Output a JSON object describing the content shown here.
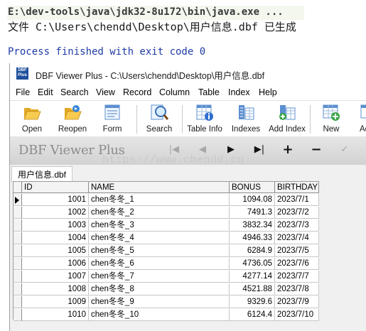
{
  "console": {
    "command": "E:\\dev-tools\\java\\jdk32-8u172\\bin\\java.exe ...",
    "output": "文件 C:\\Users\\chendd\\Desktop\\用户信息.dbf 已生成",
    "exit": "Process finished with exit code 0"
  },
  "window": {
    "logo": "DBF Plus",
    "title": "DBF Viewer Plus - C:\\Users\\chendd\\Desktop\\用户信息.dbf"
  },
  "menu": [
    "File",
    "Edit",
    "Search",
    "View",
    "Record",
    "Column",
    "Table",
    "Index",
    "Help"
  ],
  "toolbar": {
    "open": "Open",
    "reopen": "Reopen",
    "form": "Form",
    "search": "Search",
    "table_info": "Table Info",
    "indexes": "Indexes",
    "add_index": "Add Index",
    "new": "New",
    "add_partial": "Ad"
  },
  "navbar": {
    "brand": "DBF Viewer Plus"
  },
  "watermark": "https://www.chendd.cn",
  "tab": {
    "label": "用户信息.dbf"
  },
  "grid": {
    "columns": [
      "ID",
      "NAME",
      "BONUS",
      "BIRTHDAY"
    ],
    "rows": [
      {
        "id": "1001",
        "name": "chen冬冬_1",
        "bonus": "1094.08",
        "birthday": "2023/7/1"
      },
      {
        "id": "1002",
        "name": "chen冬冬_2",
        "bonus": "7491.3",
        "birthday": "2023/7/2"
      },
      {
        "id": "1003",
        "name": "chen冬冬_3",
        "bonus": "3832.34",
        "birthday": "2023/7/3"
      },
      {
        "id": "1004",
        "name": "chen冬冬_4",
        "bonus": "4946.33",
        "birthday": "2023/7/4"
      },
      {
        "id": "1005",
        "name": "chen冬冬_5",
        "bonus": "6284.9",
        "birthday": "2023/7/5"
      },
      {
        "id": "1006",
        "name": "chen冬冬_6",
        "bonus": "4736.05",
        "birthday": "2023/7/6"
      },
      {
        "id": "1007",
        "name": "chen冬冬_7",
        "bonus": "4277.14",
        "birthday": "2023/7/7"
      },
      {
        "id": "1008",
        "name": "chen冬冬_8",
        "bonus": "4521.88",
        "birthday": "2023/7/8"
      },
      {
        "id": "1009",
        "name": "chen冬冬_9",
        "bonus": "9329.6",
        "birthday": "2023/7/9"
      },
      {
        "id": "1010",
        "name": "chen冬冬_10",
        "bonus": "6124.4",
        "birthday": "2023/7/10"
      }
    ]
  },
  "colors": {
    "console_exit": "#1f3ca6",
    "logo_bg": "#1d4f9c",
    "grid_header": "#f3f3f3"
  }
}
